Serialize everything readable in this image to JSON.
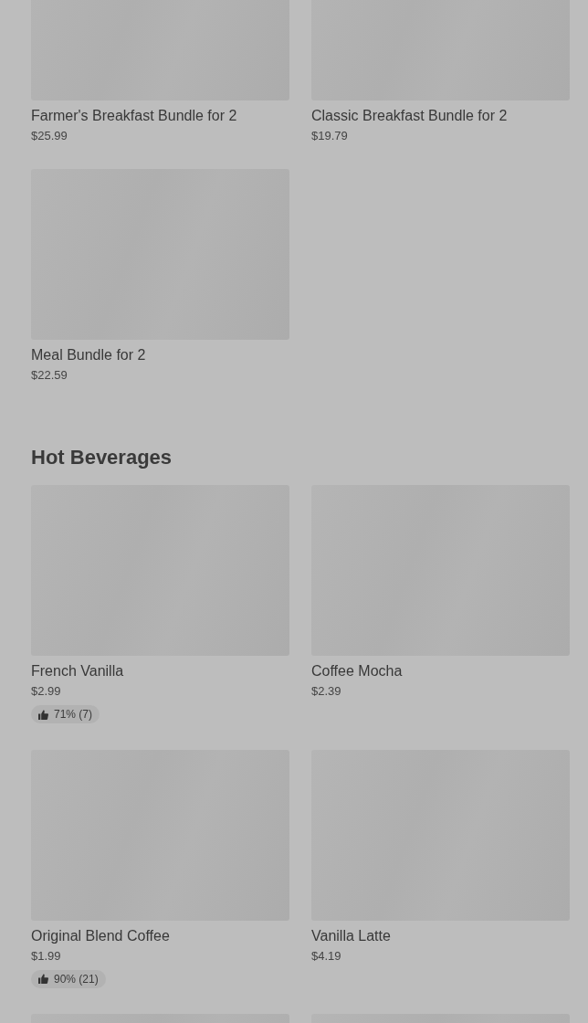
{
  "sections": [
    {
      "items": [
        {
          "kind": "product",
          "name": "Farmer's Breakfast Bundle for 2",
          "price": "$25.99"
        },
        {
          "kind": "product",
          "name": "Classic Breakfast Bundle for 2",
          "price": "$19.79"
        },
        {
          "kind": "product",
          "name": "Meal Bundle for 2",
          "price": "$22.59"
        }
      ]
    },
    {
      "heading": "Hot Beverages",
      "items": [
        {
          "kind": "product",
          "name": "French Vanilla",
          "price": "$2.99",
          "rating": "71% (7)"
        },
        {
          "kind": "product",
          "name": "Coffee Mocha",
          "price": "$2.39"
        },
        {
          "kind": "product",
          "name": "Original Blend Coffee",
          "price": "$1.99",
          "rating": "90% (21)"
        },
        {
          "kind": "product",
          "name": "Vanilla Latte",
          "price": "$4.19"
        },
        {
          "kind": "image-only"
        },
        {
          "kind": "image-only"
        }
      ]
    }
  ]
}
